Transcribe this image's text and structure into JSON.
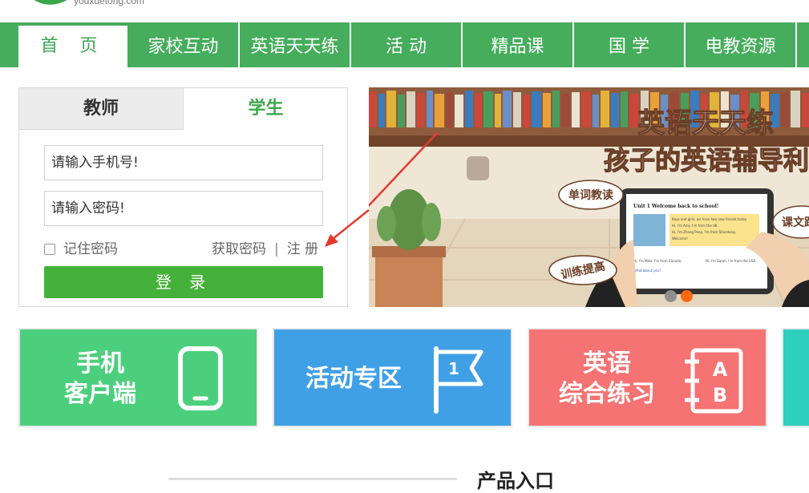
{
  "brand": {
    "url": "youxuetong.com"
  },
  "nav": {
    "items": [
      "首 页",
      "家校互动",
      "英语天天练",
      "活 动",
      "精品课",
      "国 学",
      "电教资源"
    ]
  },
  "login": {
    "tabs": {
      "teacher": "教师",
      "student": "学生"
    },
    "phone_placeholder": "请输入手机号!",
    "password_placeholder": "请输入密码!",
    "remember": "记住密码",
    "get_password": "获取密码",
    "separator": "|",
    "register": "注 册",
    "login_button": "登 录"
  },
  "banner": {
    "title": "英语天天练",
    "subtitle": "孩子的英语辅导利",
    "bubbles": [
      "单词教读",
      "课文跟",
      "训练提高"
    ],
    "tablet": {
      "heading": "Unit 1 Welcome back to school!",
      "lines": [
        "Boys and girls, we have two new friends today",
        "Hi, I'm Amy. I'm from the UK.",
        "Hi, I'm Zhang Peng. I'm from Shandong.",
        "Welcome!",
        "Hi, I'm Mike. I'm from Canada.",
        "Hi, I'm Sarah. I'm from the USA.",
        "What about you?"
      ]
    },
    "colors": {
      "active_dot": "#ff6a13",
      "inactive_dot": "#8f8f8f"
    }
  },
  "tiles": [
    {
      "label_line1": "手机",
      "label_line2": "客户端",
      "color": "#4ccf7d",
      "icon": "phone-icon"
    },
    {
      "label_line1": "活动专区",
      "color": "#40a0e6",
      "icon": "flag-icon",
      "icon_text": "1"
    },
    {
      "label_line1": "英语",
      "label_line2": "综合练习",
      "color": "#f57373",
      "icon": "book-ab-icon",
      "icon_text_a": "A",
      "icon_text_b": "B"
    },
    {
      "color": "#2fcfbf"
    }
  ],
  "section": {
    "title": "产品入口"
  }
}
